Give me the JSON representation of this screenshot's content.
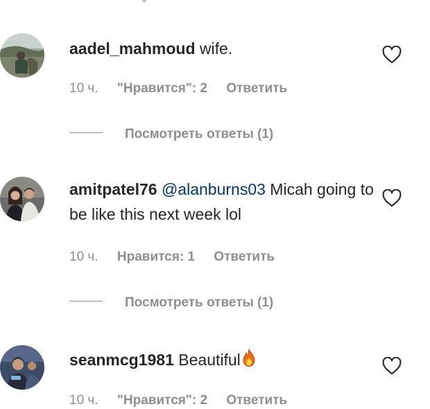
{
  "comments": [
    {
      "username": "aadel_mahmoud",
      "mention": "",
      "text": "wife.",
      "time": "10 ч.",
      "likes": "\"Нравится\": 2",
      "reply_label": "Ответить",
      "view_replies": "Посмотреть ответы (1)",
      "avatar_icon": "avatar-outdoor-photo"
    },
    {
      "username": "amitpatel76",
      "mention": "@alanburns03",
      "text": "Micah going to be like this next week lol",
      "time": "10 ч.",
      "likes": "Нравится: 1",
      "reply_label": "Ответить",
      "view_replies": "Посмотреть ответы (1)",
      "avatar_icon": "avatar-couple-photo"
    },
    {
      "username": "seanmcg1981",
      "mention": "",
      "text": "Beautiful",
      "time": "10 ч.",
      "likes": "\"Нравится\": 2",
      "reply_label": "Ответить",
      "view_replies": "",
      "avatar_icon": "avatar-group-photo",
      "emoji_icon": "fire-emoji-icon"
    }
  ],
  "colors": {
    "text": "#262626",
    "secondary": "#8e8e8e",
    "mention": "#00376b",
    "heart_stroke": "#262626"
  }
}
